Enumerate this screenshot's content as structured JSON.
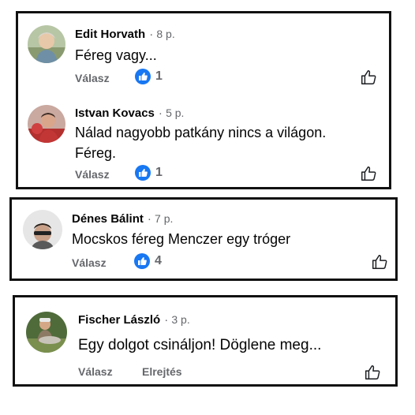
{
  "comments": [
    {
      "name": "Edit Horvath",
      "separator": "·",
      "time": "8 p.",
      "text": "Féreg vagy...",
      "reply_label": "Válasz",
      "like_count": "1"
    },
    {
      "name": "Istvan Kovacs",
      "separator": "·",
      "time": "5 p.",
      "text_line1": "Nálad nagyobb patkány nincs a világon.",
      "text_line2": "Féreg.",
      "reply_label": "Válasz",
      "like_count": "1"
    },
    {
      "name": "Dénes Bálint",
      "separator": "·",
      "time": "7 p.",
      "text": "Mocskos féreg Menczer egy tróger",
      "reply_label": "Válasz",
      "like_count": "4"
    },
    {
      "name": "Fischer László",
      "separator": "·",
      "time": "3 p.",
      "text": "Egy dolgot csináljon! Döglene meg...",
      "reply_label": "Válasz",
      "hide_label": "Elrejtés"
    }
  ],
  "colors": {
    "like_blue": "#1877f2",
    "muted_text": "#65676b",
    "border": "#111111"
  },
  "icons": {
    "like_badge": "thumbs-up-badge-icon",
    "like_button": "thumbs-up-outline-icon"
  }
}
